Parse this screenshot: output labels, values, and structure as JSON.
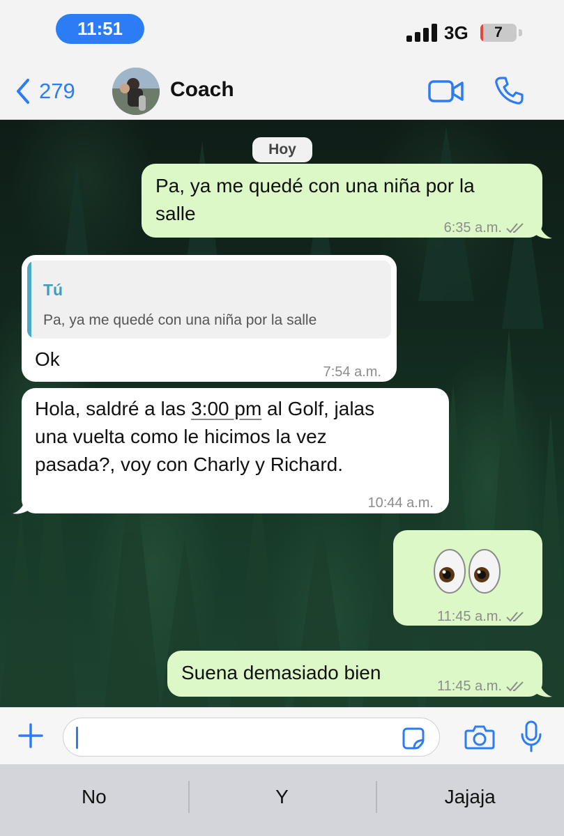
{
  "status_bar": {
    "time": "11:51",
    "network": "3G",
    "battery_level": "7",
    "signal_bars": 4,
    "colors": {
      "time_pill": "#2c7cf6",
      "battery_low": "#e2463c"
    }
  },
  "header": {
    "back_count": "279",
    "contact_name": "Coach",
    "icons": [
      "chevron-left-icon",
      "video-call-icon",
      "phone-icon"
    ],
    "accent": "#2c7cf6"
  },
  "chat": {
    "day_label": "Hoy",
    "messages": [
      {
        "direction": "outgoing",
        "text_line1": "Pa, ya me quedé con una niña por la",
        "text_line2": "salle",
        "time": "6:35 a.m.",
        "status": "read-double-check"
      },
      {
        "direction": "incoming",
        "reply_author": "Tú",
        "reply_text": "Pa, ya me quedé con una niña por la salle",
        "text": "Ok",
        "time": "7:54 a.m."
      },
      {
        "direction": "incoming",
        "text_before_time": "Hola, saldré a las ",
        "linked_time": "3:00 pm",
        "text_after_time": " al Golf, jalas",
        "text_line2": "una vuelta como le hicimos la vez",
        "text_line3": "pasada?, voy con Charly y Richard.",
        "time": "10:44 a.m."
      },
      {
        "direction": "outgoing",
        "emoji": "eyes",
        "time": "11:45 a.m.",
        "status": "read-double-check"
      },
      {
        "direction": "outgoing",
        "text": "Suena demasiado bien",
        "time": "11:45 a.m.",
        "status": "read-double-check"
      }
    ],
    "colors": {
      "outgoing_bubble": "#dcf8c6",
      "incoming_bubble": "#ffffff",
      "quote_accent": "#4aa8c8"
    }
  },
  "composer": {
    "input_value": "",
    "icons": [
      "plus-icon",
      "sticker-icon",
      "camera-icon",
      "microphone-icon"
    ]
  },
  "suggestions": [
    "No",
    "Y",
    "Jajaja"
  ]
}
